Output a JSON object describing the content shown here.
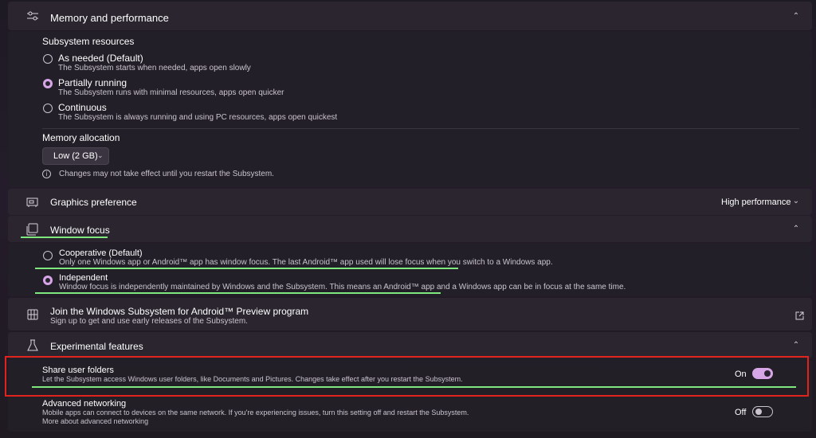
{
  "memory": {
    "title": "Memory and performance",
    "icon": "sliders-icon",
    "resources_heading": "Subsystem resources",
    "options": [
      {
        "label": "As needed (Default)",
        "desc": "The Subsystem starts when needed, apps open slowly",
        "selected": false
      },
      {
        "label": "Partially running",
        "desc": "The Subsystem runs with minimal resources, apps open quicker",
        "selected": true
      },
      {
        "label": "Continuous",
        "desc": "The Subsystem is always running and using PC resources, apps open quickest",
        "selected": false
      }
    ],
    "allocation_heading": "Memory allocation",
    "allocation_value": "Low (2 GB)",
    "note": "Changes may not take effect until you restart the Subsystem."
  },
  "graphics": {
    "title": "Graphics preference",
    "value": "High performance"
  },
  "window_focus": {
    "title": "Window focus",
    "options": [
      {
        "label": "Cooperative (Default)",
        "desc": "Only one Windows app or Android™ app has window focus. The last Android™ app used will lose focus when you switch to a Windows app.",
        "selected": false
      },
      {
        "label": "Independent",
        "desc": "Window focus is independently maintained by Windows and the Subsystem. This means an Android™ app and a Windows app can be in focus at the same time.",
        "selected": true
      }
    ]
  },
  "preview": {
    "title": "Join the Windows Subsystem for Android™ Preview program",
    "desc": "Sign up to get and use early releases of the Subsystem."
  },
  "experimental": {
    "title": "Experimental features",
    "share": {
      "title": "Share user folders",
      "desc": "Let the Subsystem access Windows user folders, like Documents and Pictures. Changes take effect after you restart the Subsystem.",
      "state": "On"
    },
    "networking": {
      "title": "Advanced networking",
      "desc": "Mobile apps can connect to devices on the same network. If you're experiencing issues, turn this setting off and restart the Subsystem.",
      "link": "More about advanced networking",
      "state": "Off"
    }
  },
  "colors": {
    "accent": "#d6a6e6",
    "highlight_box": "#e0231c",
    "underline": "#7ee87e"
  }
}
